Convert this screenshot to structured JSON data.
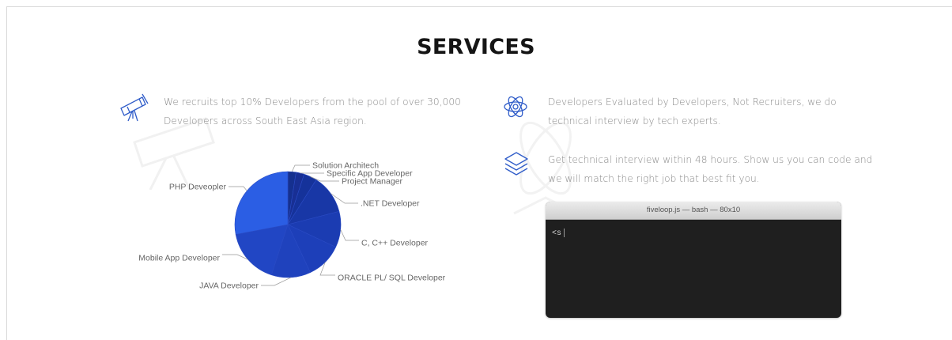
{
  "section": {
    "title": "SERVICES"
  },
  "features": [
    {
      "icon": "telescope-icon",
      "lines": [
        "We recruits top 10% Developers from the pool of over 30,000",
        "Developers across South East Asia region."
      ]
    },
    {
      "icon": "atom-icon",
      "lines": [
        "Developers Evaluated by Developers, Not Recruiters, we do",
        "technical interview by tech experts."
      ]
    },
    {
      "icon": "layers-icon",
      "lines": [
        "Get technical interview within 48 hours. Show us you can code and",
        "we will match the right job that best fit you."
      ]
    }
  ],
  "terminal": {
    "title": "fiveloop.js — bash — 80x10",
    "input": "<s"
  },
  "colors": {
    "accent": "#2f5cc9",
    "text": "#8a8a8a",
    "heading": "#151515",
    "terminal_bg": "#1f1f1f"
  },
  "chart_data": {
    "type": "pie",
    "title": "",
    "slices": [
      {
        "label": "Solution Architech",
        "value": 2.5,
        "color": "#15308f"
      },
      {
        "label": "Specific App Developer",
        "value": 2.5,
        "color": "#182f94"
      },
      {
        "label": "Project Manager",
        "value": 4,
        "color": "#15329a"
      },
      {
        "label": ".NET Developer",
        "value": 12,
        "color": "#1837a6"
      },
      {
        "label": "C, C++ Developer",
        "value": 11,
        "color": "#1b3cb2"
      },
      {
        "label": "ORACLE PL/ SQL Developer",
        "value": 11,
        "color": "#1d3fb9"
      },
      {
        "label": "JAVA Developer",
        "value": 12,
        "color": "#1f42bd"
      },
      {
        "label": "Mobile App Developer",
        "value": 17,
        "color": "#2146c4"
      },
      {
        "label": "PHP Deveopler",
        "value": 28,
        "color": "#2b5ee4"
      }
    ]
  }
}
